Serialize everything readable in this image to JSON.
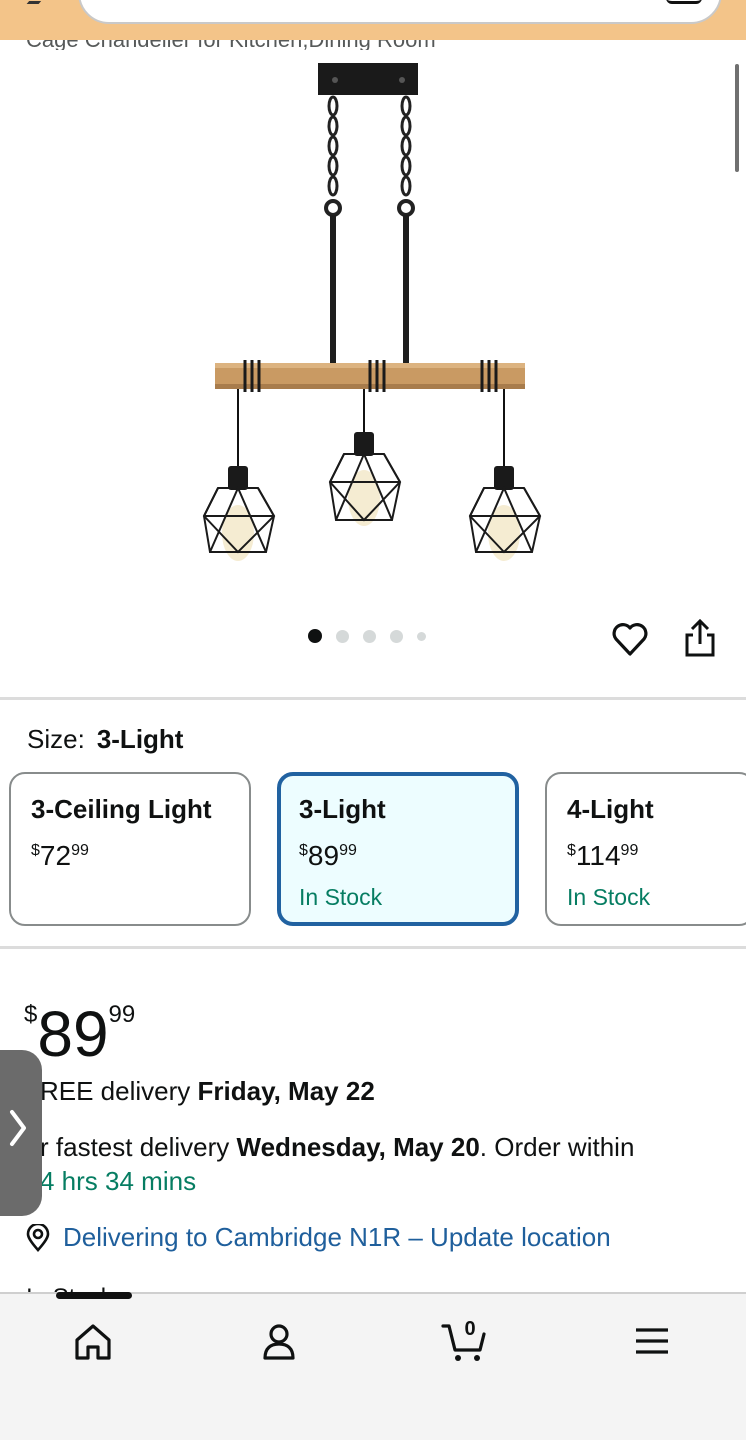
{
  "header": {
    "partial_title": "Cage Chandelier for Kitchen,Dining Room"
  },
  "gallery": {
    "image_alt": "Chandelier product image",
    "dot_count": 5,
    "active_dot": 0
  },
  "size": {
    "label": "Size:",
    "selected": "3-Light",
    "options": [
      {
        "name": "3-Ceiling Light",
        "currency": "$",
        "whole": "72",
        "fraction": "99",
        "stock": ""
      },
      {
        "name": "3-Light",
        "currency": "$",
        "whole": "89",
        "fraction": "99",
        "stock": "In Stock"
      },
      {
        "name": "4-Light",
        "currency": "$",
        "whole": "114",
        "fraction": "99",
        "stock": "In Stock"
      }
    ]
  },
  "price": {
    "currency": "$",
    "whole": "89",
    "fraction": "99"
  },
  "delivery": {
    "free_prefix": "REE delivery",
    "free_date": "Friday, May 22",
    "fast_prefix": "r fastest delivery",
    "fast_date": "Wednesday, May 20",
    "fast_suffix": ". Order within",
    "countdown": "4 hrs 34 mins",
    "location": "Delivering to Cambridge N1R – Update location",
    "stock_partial": "In Stock"
  },
  "nav": {
    "cart_count": "0"
  },
  "colors": {
    "accent_blue": "#2162a1",
    "stock_green": "#067d62",
    "link_blue": "#1f5f9c",
    "header_orange": "#f3c489"
  }
}
